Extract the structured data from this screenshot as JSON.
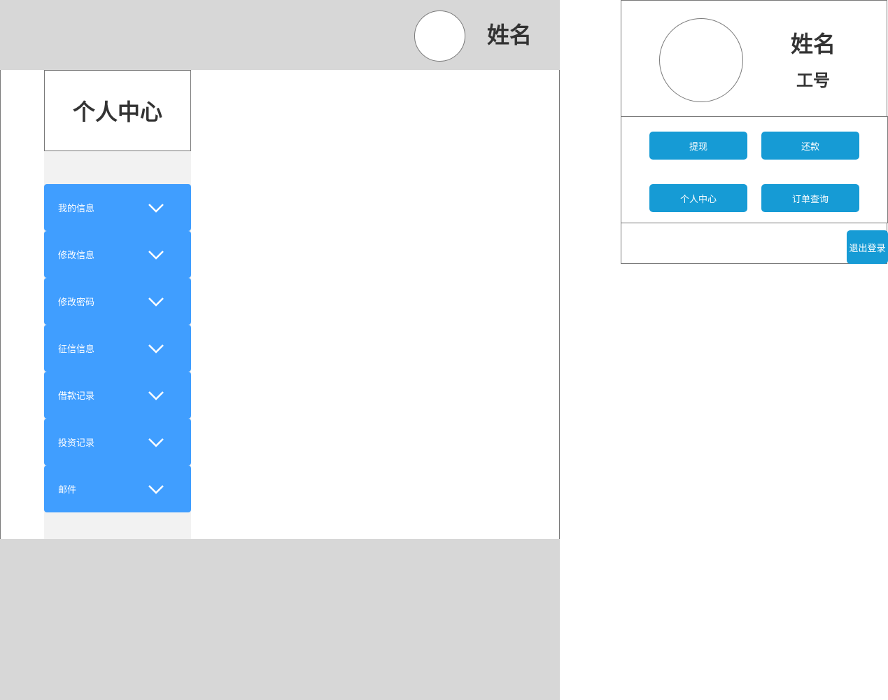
{
  "header": {
    "user_name": "姓名"
  },
  "sidebar": {
    "title": "个人中心",
    "items": [
      {
        "label": "我的信息",
        "icon": "chevron-down-icon"
      },
      {
        "label": "修改信息",
        "icon": "chevron-down-icon"
      },
      {
        "label": "修改密码",
        "icon": "chevron-down-icon"
      },
      {
        "label": "征信信息",
        "icon": "chevron-down-icon"
      },
      {
        "label": "借款记录",
        "icon": "chevron-down-icon"
      },
      {
        "label": "投资记录",
        "icon": "chevron-down-icon"
      },
      {
        "label": "邮件",
        "icon": "chevron-down-icon"
      }
    ]
  },
  "profile_card": {
    "name": "姓名",
    "employee_id": "工号",
    "actions": [
      {
        "label": "提现"
      },
      {
        "label": "还款"
      },
      {
        "label": "个人中心"
      },
      {
        "label": "订单查询"
      }
    ],
    "logout_label": "退出登录"
  },
  "colors": {
    "menu_blue": "#409eff",
    "button_blue": "#169bd5",
    "frame_gray": "#d7d7d7",
    "sidebar_gray": "#f2f2f2",
    "text_dark": "#333333"
  }
}
